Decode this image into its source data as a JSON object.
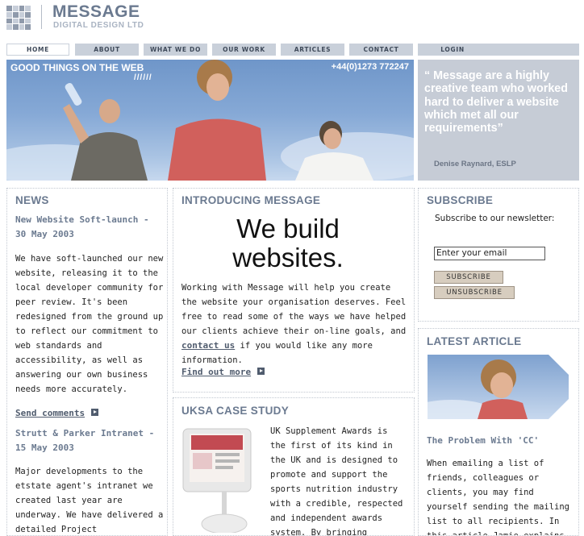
{
  "header": {
    "brand": "MESSAGE",
    "brand_sub": "DIGITAL DESIGN LTD"
  },
  "nav": {
    "items": [
      "HOME",
      "ABOUT",
      "WHAT WE DO",
      "OUR WORK",
      "ARTICLES",
      "CONTACT",
      "LOGIN"
    ]
  },
  "hero": {
    "title": "GOOD THINGS ON THE WEB",
    "slashes": "//////",
    "phone": "+44(0)1273 772247"
  },
  "quote": {
    "text": "“ Message are a highly creative team who worked hard to deliver a website which met all our requirements”",
    "author": "Denise Raynard, ESLP"
  },
  "news": {
    "title": "NEWS",
    "item1_title": "New Website Soft-launch - 30 May 2003",
    "item1_body": "We have soft-launched our new website, releasing it to the local developer community for peer review. It's been redesigned from the ground up to reflect our commitment to web standards and accessibility, as well as answering our own business needs more accurately.",
    "send_comments": "Send comments",
    "item2_title": "Strutt & Parker Intranet - 15 May 2003",
    "item2_body": "Major developments to the etstate agent's intranet we created last year are underway. We have delivered a detailed Project Specification"
  },
  "intro": {
    "title": "INTRODUCING MESSAGE",
    "headline_1": "We build",
    "headline_2": "websites.",
    "body_before": "Working with Message will help you create the website your organisation deserves. Feel free to read some of the ways we have helped our clients achieve their on-line goals, and ",
    "contact_link": "contact us",
    "body_after": " if you would like any more information.",
    "find_out_more": "Find out more"
  },
  "case_study": {
    "title": "UKSA CASE STUDY",
    "body": "UK Supplement Awards is the first of its kind in the UK and is designed to promote and support the sports nutrition industry with a credible, respected and independent awards system. By bringing together the"
  },
  "subscribe": {
    "title": "SUBSCRIBE",
    "label": "Subscribe to our newsletter:",
    "email_value": "Enter your email",
    "subscribe_btn": "SUBSCRIBE",
    "unsubscribe_btn": "UNSUBSCRIBE"
  },
  "latest": {
    "title": "LATEST ARTICLE",
    "article_title": "The Problem With 'CC'",
    "body": "When emailing a list of friends, colleagues or clients, you may find yourself sending the mailing list to all recipients. In this article Jamie explains why"
  },
  "colors": {
    "accent": "#6b7a90",
    "nav": "#c9d0da",
    "quote_bg": "#c6ccd6",
    "button": "#d7cdbf"
  }
}
